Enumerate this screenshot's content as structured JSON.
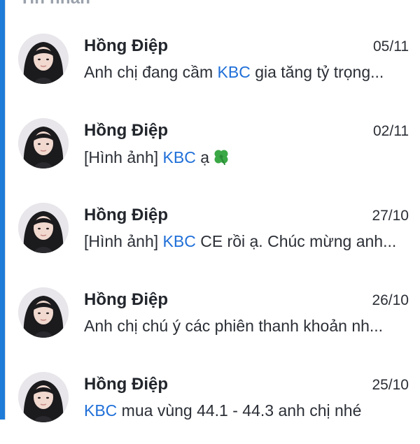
{
  "section_header": "Tin nhắn",
  "colors": {
    "accent": "#1e7bd8",
    "link": "#1f6fd8",
    "text": "#2b2f36",
    "muted": "#9aa1ab"
  },
  "messages": [
    {
      "sender": "Hồng Điệp",
      "date": "05/11",
      "preview_before": "Anh chị đang cầm ",
      "preview_highlight": "KBC",
      "preview_after": " gia tăng tỷ trọng..."
    },
    {
      "sender": "Hồng Điệp",
      "date": "02/11",
      "preview_before": "[Hình ảnh] ",
      "preview_highlight": "KBC",
      "preview_after": " ạ",
      "emoji_icon": "four-leaf-clover-icon"
    },
    {
      "sender": "Hồng Điệp",
      "date": "27/10",
      "preview_before": "[Hình ảnh] ",
      "preview_highlight": "KBC",
      "preview_after": " CE rồi ạ. Chúc mừng anh..."
    },
    {
      "sender": "Hồng Điệp",
      "date": "26/10",
      "preview_before": "Anh chị chú ý các phiên thanh khoản nh...",
      "preview_highlight": "",
      "preview_after": ""
    },
    {
      "sender": "Hồng Điệp",
      "date": "25/10",
      "preview_before": "",
      "preview_highlight": "KBC",
      "preview_after": " mua vùng 44.1 - 44.3 anh chị nhé"
    }
  ]
}
